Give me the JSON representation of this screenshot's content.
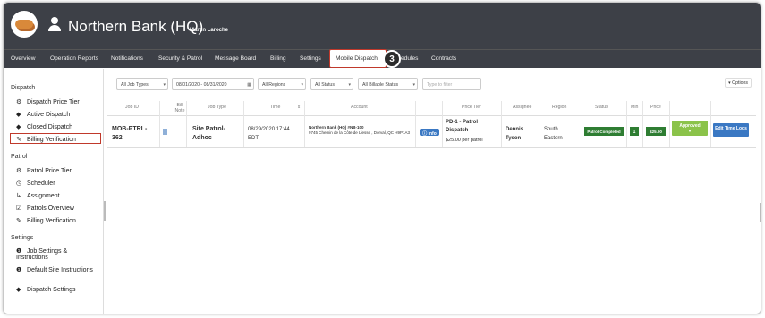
{
  "app": {
    "title": "Northern Bank (HQ)",
    "user": "Martin Laroche"
  },
  "nav": {
    "items": [
      "Overview",
      "Operation Reports",
      "Notifications",
      "Security & Patrol",
      "Message Board",
      "Billing",
      "Settings"
    ],
    "active": "Mobile Dispatch",
    "after": [
      "edules",
      "Contracts"
    ],
    "callout": "3"
  },
  "sidebar": {
    "dispatch_heading": "Dispatch",
    "dispatch_items": [
      "Dispatch Price Tier",
      "Active Dispatch",
      "Closed Dispatch",
      "Billing Verification"
    ],
    "patrol_heading": "Patrol",
    "patrol_items": [
      "Patrol Price Tier",
      "Scheduler",
      "Assignment",
      "Patrols Overview",
      "Billing Verification"
    ],
    "settings_heading": "Settings",
    "settings_items": [
      "Job Settings & Instructions",
      "Default Site Instructions",
      "Dispatch Settings"
    ]
  },
  "filters": {
    "job_types": "All Job Types",
    "date_range": "08/01/2020 - 08/31/2020",
    "regions": "All Regions",
    "status": "All Status",
    "billable": "All Billable Status",
    "search_placeholder": "Type to filter",
    "options": "▾ Options"
  },
  "table": {
    "headers": [
      "Job ID",
      "Bill Note",
      "Job Type",
      "Time",
      "Account",
      "Price Tier",
      "Assignee",
      "Region",
      "Status",
      "Min",
      "Price"
    ],
    "row": {
      "job_id": "MOB-PTRL-362",
      "job_type": "Site Patrol-Adhoc",
      "time": "08/29/2020 17:44 EDT",
      "account_name": "Northern Bank (HQ) #NB-100",
      "account_address": "9745 Chemin de la Côte de Liesse , Dorval, QC H9P1A3",
      "info": "Info",
      "price_tier": "PD-1 - Patrol Dispatch",
      "price_note": "$25.00 per patrol",
      "assignee": "Dennis Tyson",
      "region": "South Eastern",
      "status": "Patrol Completed",
      "min": "1",
      "price": "$25.00",
      "approved": "Approved",
      "edit": "Edit Time Logs"
    }
  },
  "colors": {
    "header": "#3d4047",
    "accent_red": "#c0392b",
    "status_green": "#2e7d32",
    "approved": "#8bc34a",
    "edit_blue": "#3a78c3",
    "info_blue": "#3a78c3"
  }
}
